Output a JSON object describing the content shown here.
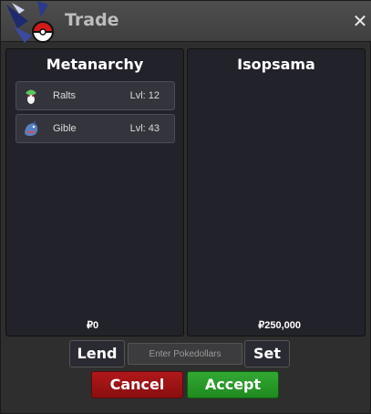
{
  "window": {
    "title": "Trade",
    "close_icon": "close-icon",
    "logo_icon": "pokeball-logo-icon"
  },
  "left_panel": {
    "player_name": "Metanarchy",
    "pokemon": [
      {
        "name": "Ralts",
        "level": "Lvl: 12",
        "icon": "ralts-sprite-icon"
      },
      {
        "name": "Gible",
        "level": "Lvl: 43",
        "icon": "gible-sprite-icon"
      }
    ],
    "money": "₽0"
  },
  "right_panel": {
    "player_name": "Isopsama",
    "pokemon": [],
    "money": "₽250,000"
  },
  "controls": {
    "lend_label": "Lend",
    "money_placeholder": "Enter Pokedollars",
    "set_label": "Set",
    "cancel_label": "Cancel",
    "accept_label": "Accept"
  },
  "colors": {
    "cancel": "#a01416",
    "accept": "#2a9e2a",
    "panel_bg": "#22222a"
  }
}
